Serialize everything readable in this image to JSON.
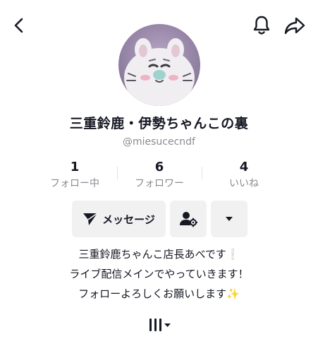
{
  "profile": {
    "display_name": "三重鈴鹿・伊勢ちゃんこの裏",
    "handle": "@miesucecndf"
  },
  "stats": [
    {
      "value": "1",
      "label": "フォロー中"
    },
    {
      "value": "6",
      "label": "フォロワー"
    },
    {
      "value": "4",
      "label": "いいね"
    }
  ],
  "actions": {
    "message_label": "メッセージ"
  },
  "bio": {
    "line1": "三重鈴鹿ちゃんこ店長あべです",
    "line1_suffix": "❕",
    "line2": "ライブ配信メインでやっていきます！",
    "line3": "フォローよろしくお願いします",
    "line3_suffix": "✨"
  },
  "icons": {
    "back": "back-arrow-icon",
    "bell": "bell-icon",
    "share": "share-icon",
    "message": "send-icon",
    "friend": "add-friend-icon",
    "more": "dropdown-icon",
    "grid": "grid-icon"
  },
  "colors": {
    "text_primary": "#161823",
    "text_secondary": "#8a8b91",
    "button_bg": "#f1f1f2"
  }
}
